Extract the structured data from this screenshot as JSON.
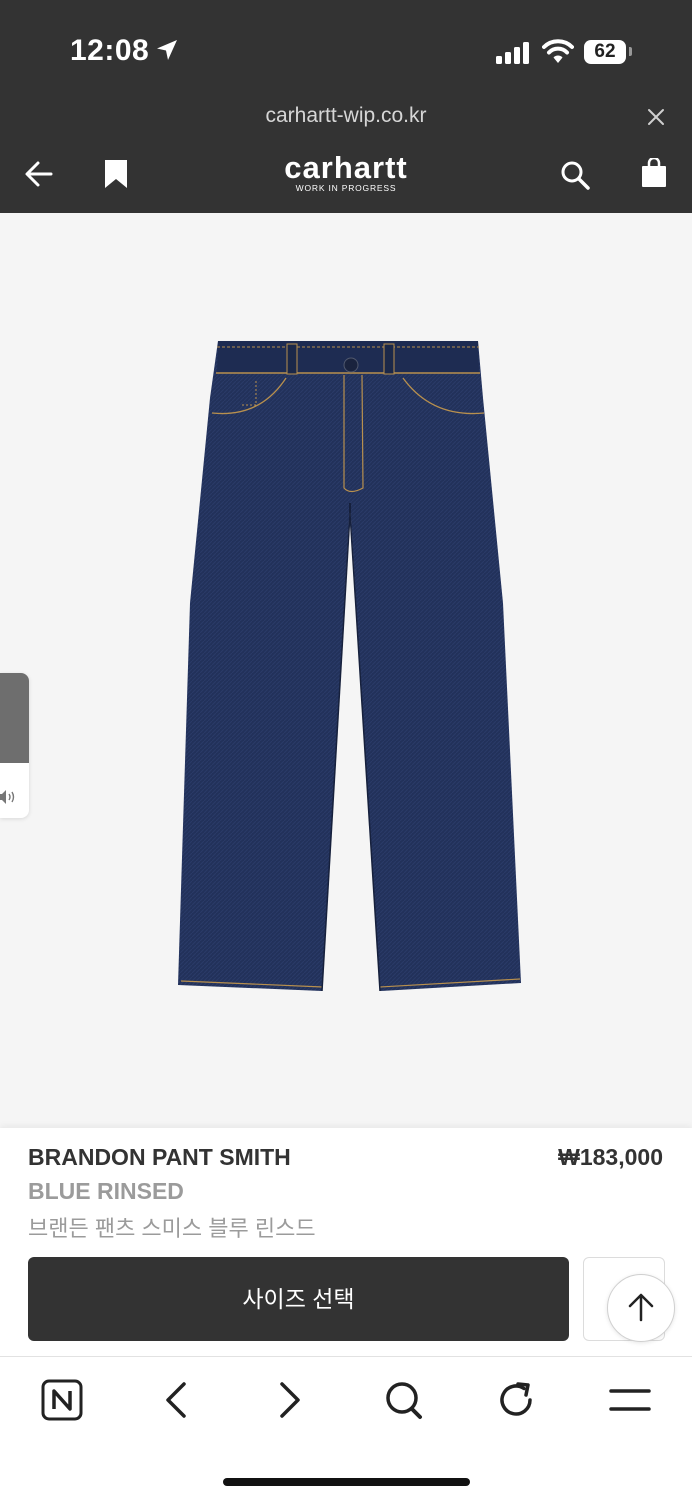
{
  "status_bar": {
    "time": "12:08",
    "battery": "62"
  },
  "browser": {
    "url": "carhartt-wip.co.kr"
  },
  "brand": {
    "name": "carhartt",
    "tagline": "WORK IN PROGRESS"
  },
  "product": {
    "name": "BRANDON PANT SMITH",
    "price": "₩183,000",
    "color": "BLUE RINSED",
    "name_kr": "브랜든 팬츠 스미스 블루 린스드"
  },
  "actions": {
    "select_size": "사이즈 선택"
  },
  "colors": {
    "header_bg": "#333333",
    "denim": "#22315a",
    "stitch": "#b8904e"
  }
}
